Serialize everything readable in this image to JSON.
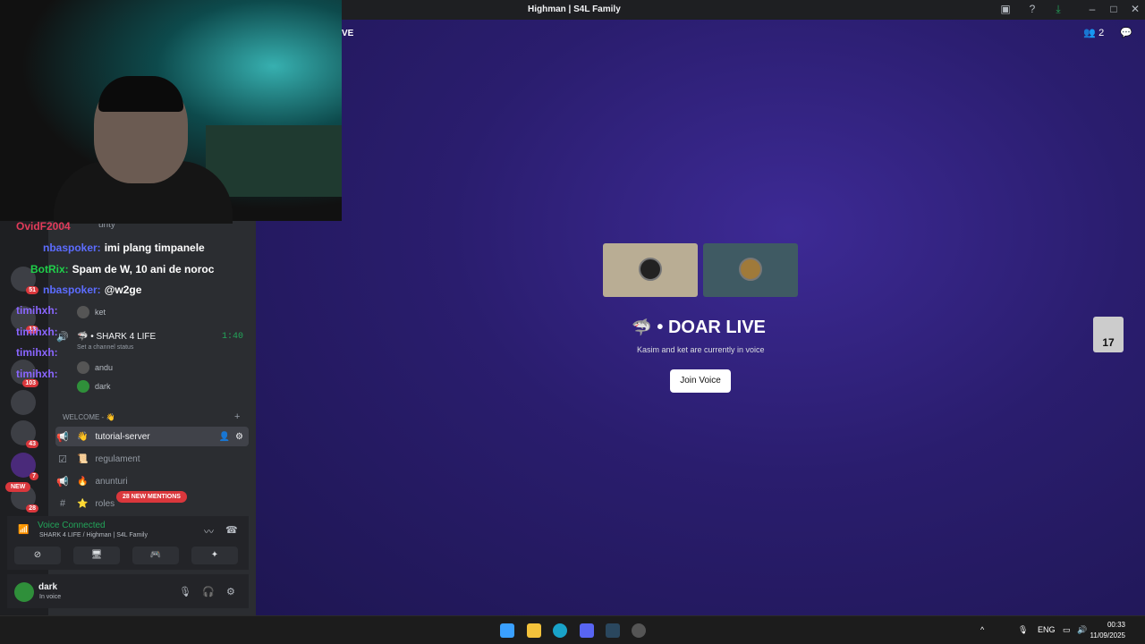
{
  "window": {
    "title": "Highman | S4L Family",
    "channel_header_fragment": "VE",
    "members_count": "2"
  },
  "channels": {
    "partial_top": "urity",
    "voice_channel": "SHARK 4 LIFE",
    "voice_timer": "1:40",
    "status_placeholder": "Set a channel status",
    "voice_users_a": [
      "ket"
    ],
    "voice_users_b": [
      "andu",
      "dark"
    ],
    "category": "WELCOME - 👋",
    "text_channels": [
      {
        "name": "tutorial-server",
        "emoji": "👋",
        "icon": "announcement-icon"
      },
      {
        "name": "regulament",
        "emoji": "📜",
        "icon": "rules-icon"
      },
      {
        "name": "anunturi",
        "emoji": "🔥",
        "icon": "announcement-icon"
      },
      {
        "name": "roles",
        "emoji": "⭐",
        "icon": "hash-icon"
      }
    ],
    "mentions_pill": "28 NEW MENTIONS",
    "new_badge": "NEW"
  },
  "guild_badges": [
    "51",
    "13",
    "103",
    "43",
    "7",
    "28"
  ],
  "voice_panel": {
    "status": "Voice Connected",
    "location": "SHARK 4 LIFE / Highman | S4L Family"
  },
  "user_panel": {
    "name": "dark",
    "status": "In voice"
  },
  "stage": {
    "channel_name": "DOAR LIVE",
    "subtitle": "Kasim and ket are currently in voice",
    "join_label": "Join Voice",
    "floating_badge": "17"
  },
  "chat_overlay": [
    {
      "user": "OvidF2004",
      "color": "#e23b5a",
      "message": ""
    },
    {
      "user": "nbaspoker:",
      "color": "#5c6cff",
      "message": "imi plang timpanele"
    },
    {
      "user": "BotRix:",
      "color": "#1fcf4a",
      "message": "Spam de W, 10 ani de noroc"
    },
    {
      "user": "nbaspoker:",
      "color": "#5c6cff",
      "message": "@w2ge"
    },
    {
      "user": "timihxh:",
      "color": "#8a66ff",
      "message": ""
    },
    {
      "user": "timihxh:",
      "color": "#8a66ff",
      "message": ""
    },
    {
      "user": "timihxh:",
      "color": "#8a66ff",
      "message": ""
    },
    {
      "user": "timihxh:",
      "color": "#8a66ff",
      "message": ""
    }
  ],
  "taskbar": {
    "lang": "ENG",
    "time": "00:33",
    "date": "11/09/2025"
  }
}
